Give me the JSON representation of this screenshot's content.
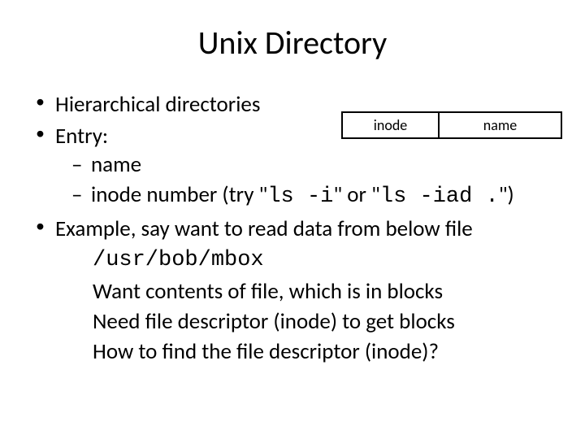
{
  "title": "Unix Directory",
  "bullets": {
    "b1": "Hierarchical directories",
    "b2": "Entry:",
    "b2_sub1": "name",
    "b2_sub2_pre": "inode number (try \"",
    "b2_sub2_code1": "ls -i",
    "b2_sub2_mid": "\" or \"",
    "b2_sub2_code2": "ls -iad .",
    "b2_sub2_post": "\")",
    "b3": "Example, say want to read data from below file",
    "b3_line1": "/usr/bob/mbox",
    "b3_line2": "Want contents of file, which is in blocks",
    "b3_line3": "Need file descriptor (inode) to get blocks",
    "b3_line4": "How to find the file descriptor (inode)?"
  },
  "entry_box": {
    "left": "inode",
    "right": "name"
  }
}
